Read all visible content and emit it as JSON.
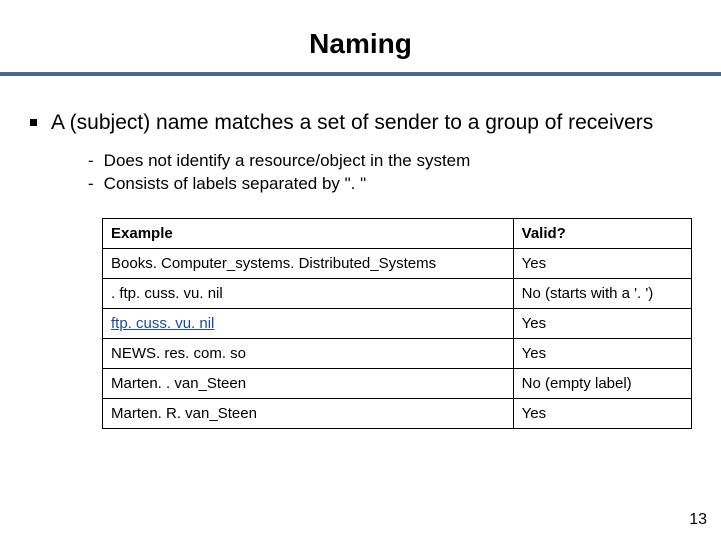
{
  "title": "Naming",
  "bullet": "A (subject) name matches a set of sender to a group of receivers",
  "subitems": [
    "Does not identify a resource/object in the system",
    "Consists of labels separated by \". \""
  ],
  "table": {
    "headers": {
      "example": "Example",
      "valid": "Valid?"
    },
    "rows": [
      {
        "example": "Books. Computer_systems. Distributed_Systems",
        "valid": "Yes",
        "link": false
      },
      {
        "example": ". ftp. cuss. vu. nil",
        "valid": "No (starts with a '. ')",
        "link": false
      },
      {
        "example": "ftp. cuss. vu. nil",
        "valid": "Yes",
        "link": true
      },
      {
        "example": "NEWS. res. com. so",
        "valid": "Yes",
        "link": false
      },
      {
        "example": "Marten. . van_Steen",
        "valid": "No (empty label)",
        "link": false
      },
      {
        "example": "Marten. R. van_Steen",
        "valid": "Yes",
        "link": false
      }
    ]
  },
  "page_number": "13"
}
